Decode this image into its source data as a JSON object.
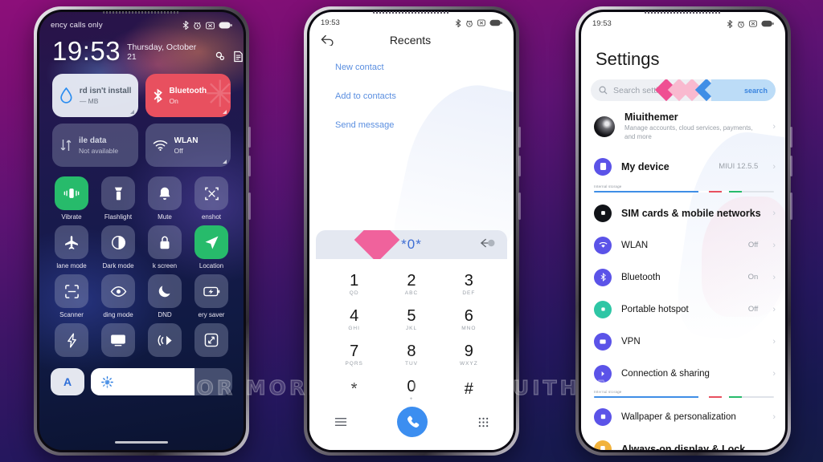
{
  "watermark": "VISIT FOR MORE THEMES - MIUITHEMER.COM",
  "colors": {
    "bg_top": "#8d0f7a",
    "bg_bottom": "#141b45",
    "accent_blue": "#3c8ef0",
    "accent_purple": "#5b53e8",
    "accent_green": "#27bb6b",
    "accent_pink": "#f0629c",
    "tile_red": "#e8505f"
  },
  "phone1": {
    "name": "control-center",
    "statusbar": {
      "carrier": "ency calls only",
      "icons": [
        "bluetooth-icon",
        "alarm-icon",
        "silent-icon",
        "battery-icon"
      ]
    },
    "clock": {
      "time": "19:53",
      "date": "Thursday, October 21",
      "icons": [
        "settings-gear-icon",
        "edit-note-icon"
      ]
    },
    "big_tiles": [
      {
        "title": "rd isn't install",
        "sub": "— MB",
        "icon": "data-drop-icon",
        "state": "light"
      },
      {
        "title": "Bluetooth",
        "sub": "On",
        "icon": "bluetooth-icon",
        "state": "active"
      },
      {
        "title": "ile data",
        "sub": "Not available",
        "icon": "mobile-data-icon",
        "state": "disabled"
      },
      {
        "title": "WLAN",
        "sub": "Off",
        "icon": "wifi-icon",
        "state": "off"
      }
    ],
    "quick_tiles": [
      {
        "label": "Vibrate",
        "icon": "vibrate-icon",
        "on": true
      },
      {
        "label": "Flashlight",
        "icon": "flashlight-icon",
        "on": false
      },
      {
        "label": "Mute",
        "icon": "bell-icon",
        "on": false
      },
      {
        "label": "enshot",
        "icon": "screenshot-icon",
        "on": false
      },
      {
        "label": "lane mode",
        "icon": "airplane-icon",
        "on": false
      },
      {
        "label": "Dark mode",
        "icon": "dark-mode-icon",
        "on": false
      },
      {
        "label": "k screen",
        "icon": "lock-icon",
        "on": false
      },
      {
        "label": "Location",
        "icon": "location-arrow-icon",
        "on": true
      },
      {
        "label": "Scanner",
        "icon": "scanner-icon",
        "on": false
      },
      {
        "label": "ding mode",
        "icon": "reading-mode-eye-icon",
        "on": false
      },
      {
        "label": "DND",
        "icon": "moon-icon",
        "on": false
      },
      {
        "label": "ery saver",
        "icon": "battery-saver-icon",
        "on": false
      },
      {
        "label": "",
        "icon": "lightning-icon",
        "on": false
      },
      {
        "label": "",
        "icon": "cast-icon",
        "on": false
      },
      {
        "label": "",
        "icon": "nfc-icon",
        "on": false
      },
      {
        "label": "",
        "icon": "fullscreen-icon",
        "on": false
      }
    ],
    "brightness": {
      "auto_label": "A",
      "icon": "brightness-sun-icon",
      "level_percent": 66
    }
  },
  "phone2": {
    "name": "phone-dialer",
    "statusbar": {
      "time": "19:53",
      "icons": [
        "bluetooth-icon",
        "alarm-icon",
        "silent-icon",
        "battery-icon"
      ]
    },
    "header": {
      "back_icon": "back-arrow-icon",
      "title": "Recents"
    },
    "actions": [
      "New contact",
      "Add to contacts",
      "Send message"
    ],
    "input": {
      "value": "*0*",
      "backspace_icon": "backspace-icon"
    },
    "keys": [
      {
        "num": "1",
        "sub": "QD"
      },
      {
        "num": "2",
        "sub": "ABC"
      },
      {
        "num": "3",
        "sub": "DEF"
      },
      {
        "num": "4",
        "sub": "GHI"
      },
      {
        "num": "5",
        "sub": "JKL"
      },
      {
        "num": "6",
        "sub": "MNO"
      },
      {
        "num": "7",
        "sub": "PQRS"
      },
      {
        "num": "8",
        "sub": "TUV"
      },
      {
        "num": "9",
        "sub": "WXYZ"
      },
      {
        "num": "*",
        "sub": ""
      },
      {
        "num": "0",
        "sub": "+"
      },
      {
        "num": "#",
        "sub": ""
      }
    ],
    "bottom_bar": [
      "menu-lines-icon",
      "call-button",
      "keypad-grid-icon"
    ]
  },
  "phone3": {
    "name": "settings",
    "statusbar": {
      "time": "19:53",
      "icons": [
        "bluetooth-icon",
        "alarm-icon",
        "silent-icon",
        "battery-icon"
      ]
    },
    "title": "Settings",
    "search": {
      "placeholder": "Search settings",
      "icon": "search-icon",
      "deco_label": "search"
    },
    "account": {
      "name": "Miuithemer",
      "subtitle": "Manage accounts, cloud services, payments, and more",
      "avatar": "avatar"
    },
    "storage": {
      "label": "Internal storage"
    },
    "rows": [
      {
        "label": "My device",
        "value": "MIUI 12.5.5",
        "icon": "device-icon",
        "color": "#5b53e8",
        "big": true
      },
      {
        "label": "SIM cards & mobile networks",
        "value": "",
        "icon": "sim-card-icon",
        "color": "#111318",
        "big": true
      },
      {
        "label": "WLAN",
        "value": "Off",
        "icon": "wifi-icon",
        "color": "#5b53e8",
        "big": false
      },
      {
        "label": "Bluetooth",
        "value": "On",
        "icon": "bluetooth-icon",
        "color": "#5b53e8",
        "big": false
      },
      {
        "label": "Portable hotspot",
        "value": "Off",
        "icon": "hotspot-icon",
        "color": "#2ec6a5",
        "big": false
      },
      {
        "label": "VPN",
        "value": "",
        "icon": "vpn-icon",
        "color": "#5b53e8",
        "big": false
      },
      {
        "label": "Connection & sharing",
        "value": "",
        "icon": "sharing-icon",
        "color": "#5b53e8",
        "big": false
      },
      {
        "label": "Wallpaper & personalization",
        "value": "",
        "icon": "wallpaper-icon",
        "color": "#5b53e8",
        "big": false
      },
      {
        "label": "Always-on display & Lock",
        "value": "",
        "icon": "aod-icon",
        "color": "#f2b33c",
        "big": false
      }
    ]
  }
}
